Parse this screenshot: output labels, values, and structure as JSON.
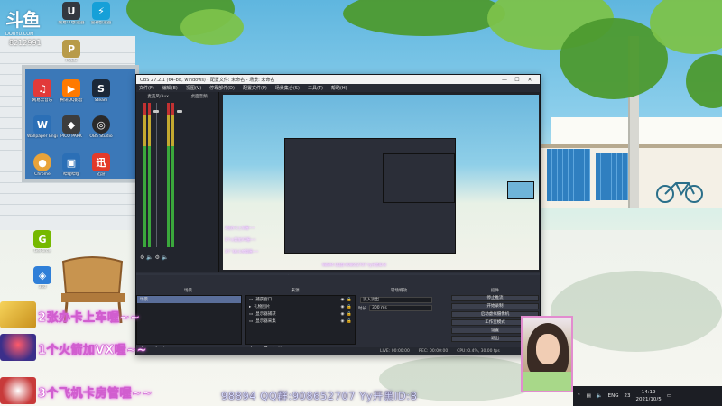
{
  "desktop": {
    "logo": {
      "brand": "斗鱼",
      "domain": "DOUYU.COM"
    },
    "room_number": "8212991",
    "icons": [
      {
        "label": "网易云音乐",
        "color": "#e23a3a",
        "glyph": "♫"
      },
      {
        "label": "腾讯QQ影音",
        "color": "#ff7a00",
        "glyph": "▶"
      },
      {
        "label": "网易UU加速器",
        "color": "#333840",
        "glyph": "U"
      },
      {
        "label": "雷神加速器",
        "color": "#16a0d8",
        "glyph": "⚡"
      },
      {
        "label": "PUBG",
        "color": "#b89b49",
        "glyph": "P"
      },
      {
        "label": "Wallpaper Engine",
        "color": "#2b6fb6",
        "glyph": "W"
      },
      {
        "label": "PICO PARK",
        "color": "#3d3d3d",
        "glyph": "◆"
      },
      {
        "label": "OBS Studio",
        "color": "#2a2a2a",
        "glyph": "◎"
      },
      {
        "label": "Chrome",
        "color": "#e8a33a",
        "glyph": "●"
      },
      {
        "label": "哔哩哔哩",
        "color": "#2b6fb6",
        "glyph": "▣"
      },
      {
        "label": "Steam",
        "color": "#1b2838",
        "glyph": "S"
      },
      {
        "label": "迅游",
        "color": "#e33a2a",
        "glyph": "迅"
      },
      {
        "label": "GeForce",
        "color": "#76b900",
        "glyph": "G"
      },
      {
        "label": "360",
        "color": "#2f7fd8",
        "glyph": "◈"
      }
    ]
  },
  "overlays": {
    "banners": [
      {
        "text": "2张办卡上车喔~~",
        "badge_color": "#e6b72a"
      },
      {
        "text": "1个火箭加VX喔~~",
        "badge_color": "#3b2f8a"
      },
      {
        "text": "3个飞机卡房管喔~~",
        "badge_color": "#c83a3a"
      }
    ],
    "bottom_text": "98894   QQ群:908652707   Yy开黑ID:8"
  },
  "obs": {
    "title": "OBS 27.2.1 (64-bit, windows) - 配置文件: 未命名 - 场景: 未命名",
    "menu": [
      "文件(F)",
      "编辑(E)",
      "视图(V)",
      "停靠部件(D)",
      "配置文件(P)",
      "场景集合(S)",
      "工具(T)",
      "帮助(H)"
    ],
    "mixer": {
      "channels": [
        "麦克风/Aux",
        "桌面音频"
      ],
      "controls": "⚙ 🔈  ⚙ 🔈"
    },
    "scene_bar_items": [
      "未选择源",
      "⚙ 属性",
      "⧉ 滤镜"
    ],
    "docks": {
      "scenes_title": "场景",
      "sources_title": "来源",
      "transitions_title": "转场特效",
      "controls_title": "控件",
      "scenes": [
        "场景"
      ],
      "sources": [
        "捕获窗口",
        "礼物图片",
        "显示器捕获",
        "显示器采集"
      ],
      "transition": {
        "type": "淡入淡出",
        "duration_label": "时长",
        "duration": "300 ms"
      },
      "controls": [
        "停止推流",
        "开始录制",
        "启动虚拟摄像机",
        "工作室模式",
        "设置",
        "退出"
      ]
    },
    "status": [
      "LIVE: 00:00:00",
      "REC: 00:00:00",
      "CPU: 0.4%, 30.00 fps"
    ]
  },
  "taskbar": {
    "lang": "ENG",
    "time": "14:19",
    "date": "2021/10/5",
    "extra": "23"
  }
}
